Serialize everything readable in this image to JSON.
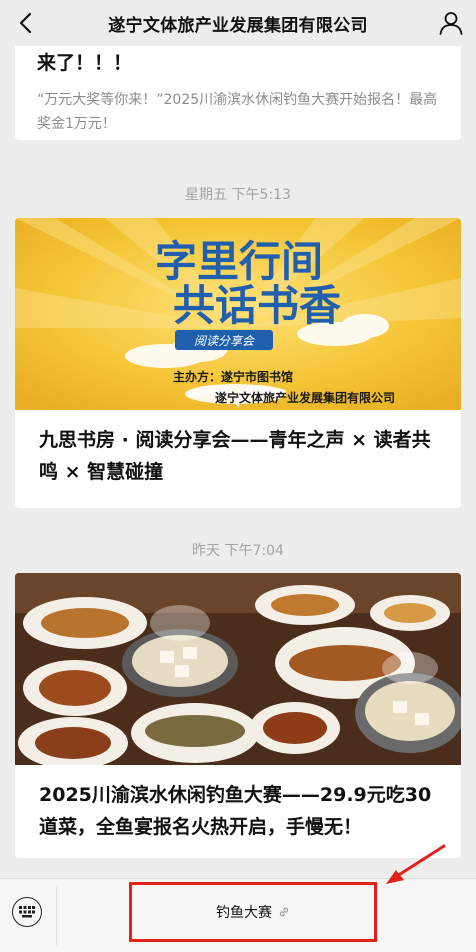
{
  "header": {
    "title": "遂宁文体旅产业发展集团有限公司"
  },
  "messages": [
    {
      "headline": "来了！！！",
      "desc": "“万元大奖等你来！”2025川渝滨水休闲钓鱼大赛开始报名！最高奖金1万元！"
    },
    {
      "time": "星期五 下午5:13",
      "cover": {
        "line1": "字里行间",
        "line2": "共话书香",
        "tag": "阅读分享会",
        "organizer": "主办方：遂宁市图书馆",
        "organizer2": "遂宁文体旅产业发展集团有限公司"
      },
      "title": "九思书房 · 阅读分享会——青年之声 × 读者共鸣 × 智慧碰撞"
    },
    {
      "time": "昨天 下午7:04",
      "title": "2025川渝滨水休闲钓鱼大赛——29.9元吃30道菜，全鱼宴报名火热开启，手慢无！"
    }
  ],
  "bottom_menu": {
    "item": "钓鱼大赛",
    "item_icon": "link-icon"
  },
  "colors": {
    "background": "#ededed",
    "highlight": "#e5211d",
    "book_cover_bg": "#f2c230"
  }
}
